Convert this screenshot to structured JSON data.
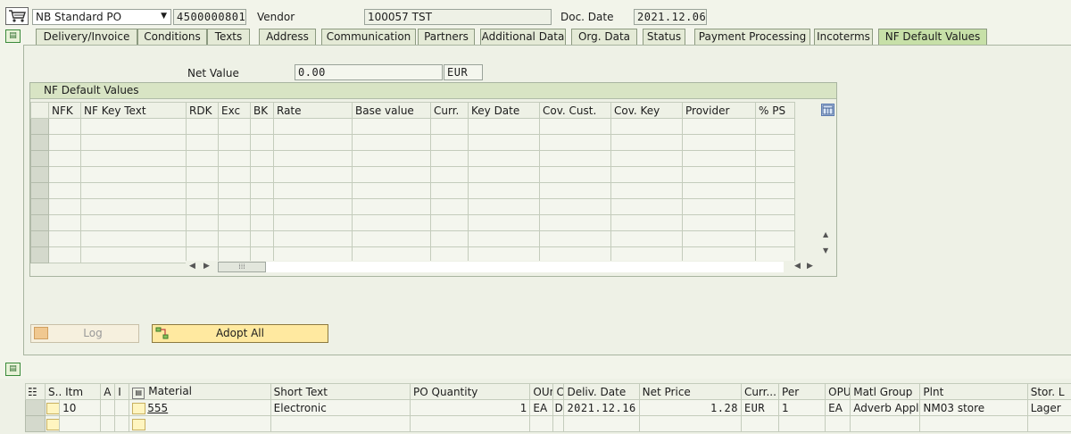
{
  "header": {
    "doc_type": "NB Standard PO",
    "po_number": "4500000801",
    "vendor_label": "Vendor",
    "vendor_value": "100057 TST",
    "doc_date_label": "Doc. Date",
    "doc_date_value": "2021.12.06"
  },
  "tabs": [
    {
      "label": "Delivery/Invoice"
    },
    {
      "label": "Conditions"
    },
    {
      "label": "Texts"
    },
    {
      "label": "Address"
    },
    {
      "label": "Communication"
    },
    {
      "label": "Partners"
    },
    {
      "label": "Additional Data"
    },
    {
      "label": "Org. Data"
    },
    {
      "label": "Status"
    },
    {
      "label": "Payment Processing"
    },
    {
      "label": "Incoterms"
    },
    {
      "label": "NF Default Values",
      "active": true
    }
  ],
  "net_value": {
    "label": "Net Value",
    "value": "0.00",
    "currency": "EUR"
  },
  "nf_grid": {
    "title": "NF Default Values",
    "columns": [
      "NFK",
      "NF Key Text",
      "RDK",
      "Exc",
      "BK",
      "Rate",
      "Base value",
      "Curr.",
      "Key Date",
      "Cov. Cust.",
      "Cov. Key",
      "Provider",
      "% PS"
    ]
  },
  "buttons": {
    "log": "Log",
    "adopt_all": "Adopt All"
  },
  "items": {
    "columns": [
      "S..",
      "Itm",
      "A",
      "I",
      "Material",
      "Short Text",
      "PO Quantity",
      "OUn",
      "C",
      "Deliv. Date",
      "Net Price",
      "Curr...",
      "Per",
      "OPU",
      "Matl Group",
      "Plnt",
      "Stor. L"
    ],
    "rows": [
      {
        "itm": "10",
        "material": "555",
        "short_text": "Electronic",
        "po_qty": "1",
        "oun": "EA",
        "c": "D",
        "deliv_date": "2021.12.16",
        "net_price": "1.28",
        "curr": "EUR",
        "per": "1",
        "opu": "EA",
        "matl_group": "Adverb Apple",
        "plnt": "NM03 store",
        "stor": "Lager"
      }
    ]
  },
  "colors": {
    "background": "#f2f4ea",
    "active_tab": "#c7e0a8",
    "adopt_button": "#ffe9a0"
  }
}
